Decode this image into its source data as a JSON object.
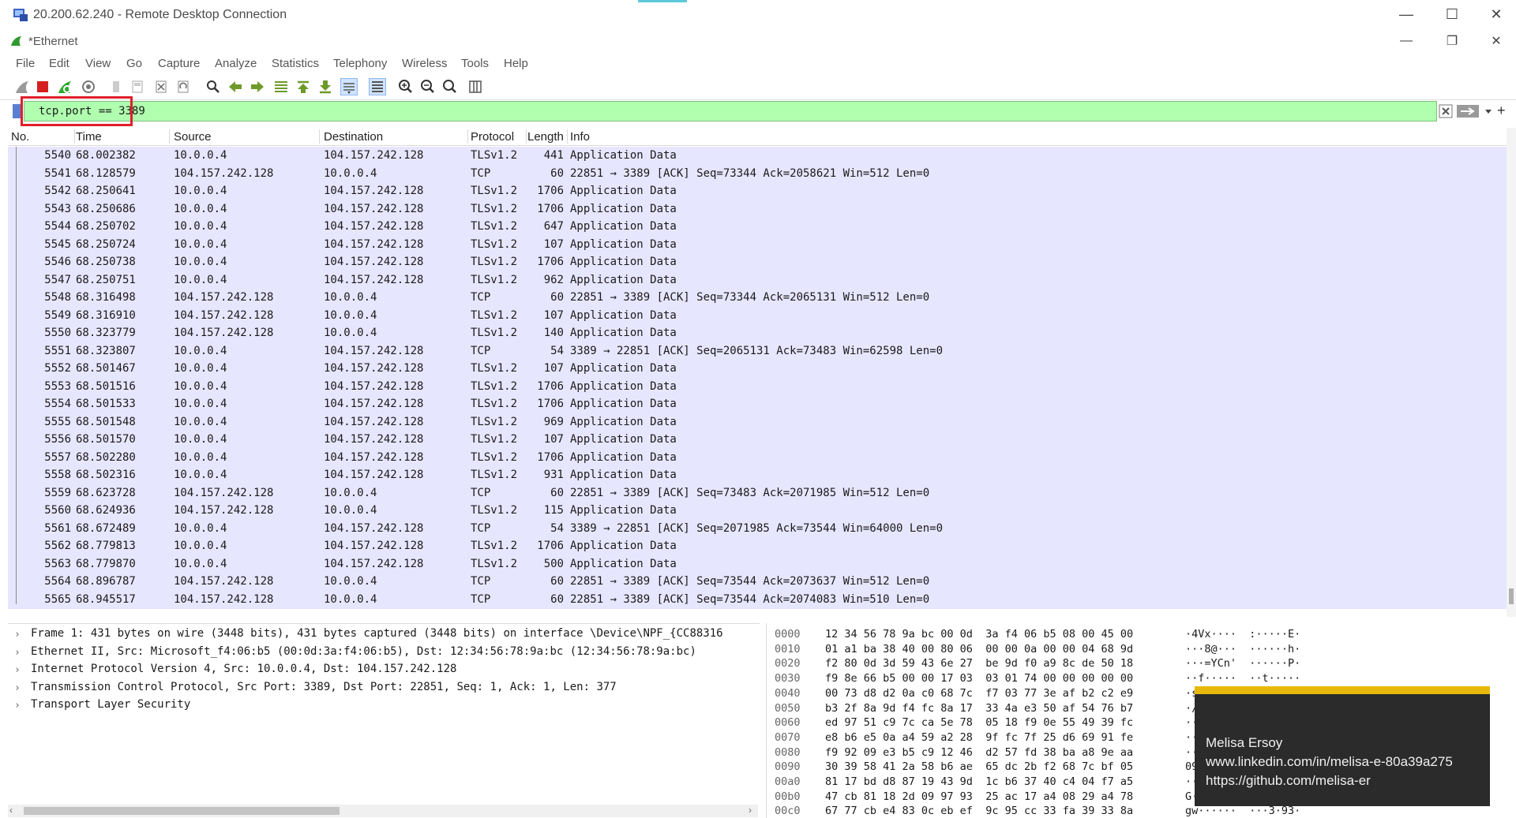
{
  "rdp": {
    "title": "20.200.62.240 - Remote Desktop Connection"
  },
  "app": {
    "title": "*Ethernet"
  },
  "menu": [
    "File",
    "Edit",
    "View",
    "Go",
    "Capture",
    "Analyze",
    "Statistics",
    "Telephony",
    "Wireless",
    "Tools",
    "Help"
  ],
  "filter": {
    "value": "tcp.port == 3389",
    "plus": "+"
  },
  "columns": [
    "No.",
    "Time",
    "Source",
    "Destination",
    "Protocol",
    "Length",
    "Info"
  ],
  "packets": [
    [
      "5540",
      "68.002382",
      "10.0.0.4",
      "104.157.242.128",
      "TLSv1.2",
      "441",
      "Application Data"
    ],
    [
      "5541",
      "68.128579",
      "104.157.242.128",
      "10.0.0.4",
      "TCP",
      "60",
      "22851 → 3389 [ACK] Seq=73344 Ack=2058621 Win=512 Len=0"
    ],
    [
      "5542",
      "68.250641",
      "10.0.0.4",
      "104.157.242.128",
      "TLSv1.2",
      "1706",
      "Application Data"
    ],
    [
      "5543",
      "68.250686",
      "10.0.0.4",
      "104.157.242.128",
      "TLSv1.2",
      "1706",
      "Application Data"
    ],
    [
      "5544",
      "68.250702",
      "10.0.0.4",
      "104.157.242.128",
      "TLSv1.2",
      "647",
      "Application Data"
    ],
    [
      "5545",
      "68.250724",
      "10.0.0.4",
      "104.157.242.128",
      "TLSv1.2",
      "107",
      "Application Data"
    ],
    [
      "5546",
      "68.250738",
      "10.0.0.4",
      "104.157.242.128",
      "TLSv1.2",
      "1706",
      "Application Data"
    ],
    [
      "5547",
      "68.250751",
      "10.0.0.4",
      "104.157.242.128",
      "TLSv1.2",
      "962",
      "Application Data"
    ],
    [
      "5548",
      "68.316498",
      "104.157.242.128",
      "10.0.0.4",
      "TCP",
      "60",
      "22851 → 3389 [ACK] Seq=73344 Ack=2065131 Win=512 Len=0"
    ],
    [
      "5549",
      "68.316910",
      "104.157.242.128",
      "10.0.0.4",
      "TLSv1.2",
      "107",
      "Application Data"
    ],
    [
      "5550",
      "68.323779",
      "104.157.242.128",
      "10.0.0.4",
      "TLSv1.2",
      "140",
      "Application Data"
    ],
    [
      "5551",
      "68.323807",
      "10.0.0.4",
      "104.157.242.128",
      "TCP",
      "54",
      "3389 → 22851 [ACK] Seq=2065131 Ack=73483 Win=62598 Len=0"
    ],
    [
      "5552",
      "68.501467",
      "10.0.0.4",
      "104.157.242.128",
      "TLSv1.2",
      "107",
      "Application Data"
    ],
    [
      "5553",
      "68.501516",
      "10.0.0.4",
      "104.157.242.128",
      "TLSv1.2",
      "1706",
      "Application Data"
    ],
    [
      "5554",
      "68.501533",
      "10.0.0.4",
      "104.157.242.128",
      "TLSv1.2",
      "1706",
      "Application Data"
    ],
    [
      "5555",
      "68.501548",
      "10.0.0.4",
      "104.157.242.128",
      "TLSv1.2",
      "969",
      "Application Data"
    ],
    [
      "5556",
      "68.501570",
      "10.0.0.4",
      "104.157.242.128",
      "TLSv1.2",
      "107",
      "Application Data"
    ],
    [
      "5557",
      "68.502280",
      "10.0.0.4",
      "104.157.242.128",
      "TLSv1.2",
      "1706",
      "Application Data"
    ],
    [
      "5558",
      "68.502316",
      "10.0.0.4",
      "104.157.242.128",
      "TLSv1.2",
      "931",
      "Application Data"
    ],
    [
      "5559",
      "68.623728",
      "104.157.242.128",
      "10.0.0.4",
      "TCP",
      "60",
      "22851 → 3389 [ACK] Seq=73483 Ack=2071985 Win=512 Len=0"
    ],
    [
      "5560",
      "68.624936",
      "104.157.242.128",
      "10.0.0.4",
      "TLSv1.2",
      "115",
      "Application Data"
    ],
    [
      "5561",
      "68.672489",
      "10.0.0.4",
      "104.157.242.128",
      "TCP",
      "54",
      "3389 → 22851 [ACK] Seq=2071985 Ack=73544 Win=64000 Len=0"
    ],
    [
      "5562",
      "68.779813",
      "10.0.0.4",
      "104.157.242.128",
      "TLSv1.2",
      "1706",
      "Application Data"
    ],
    [
      "5563",
      "68.779870",
      "10.0.0.4",
      "104.157.242.128",
      "TLSv1.2",
      "500",
      "Application Data"
    ],
    [
      "5564",
      "68.896787",
      "104.157.242.128",
      "10.0.0.4",
      "TCP",
      "60",
      "22851 → 3389 [ACK] Seq=73544 Ack=2073637 Win=512 Len=0"
    ],
    [
      "5565",
      "68.945517",
      "104.157.242.128",
      "10.0.0.4",
      "TCP",
      "60",
      "22851 → 3389 [ACK] Seq=73544 Ack=2074083 Win=510 Len=0"
    ]
  ],
  "details": [
    "Frame 1: 431 bytes on wire (3448 bits), 431 bytes captured (3448 bits) on interface \\Device\\NPF_{CC88316",
    "Ethernet II, Src: Microsoft_f4:06:b5 (00:0d:3a:f4:06:b5), Dst: 12:34:56:78:9a:bc (12:34:56:78:9a:bc)",
    "Internet Protocol Version 4, Src: 10.0.0.4, Dst: 104.157.242.128",
    "Transmission Control Protocol, Src Port: 3389, Dst Port: 22851, Seq: 1, Ack: 1, Len: 377",
    "Transport Layer Security"
  ],
  "bytes": [
    [
      "0000",
      "12 34 56 78 9a bc 00 0d  3a f4 06 b5 08 00 45 00",
      "·4Vx····  :·····E·"
    ],
    [
      "0010",
      "01 a1 ba 38 40 00 80 06  00 00 0a 00 00 04 68 9d",
      "···8@···  ······h·"
    ],
    [
      "0020",
      "f2 80 0d 3d 59 43 6e 27  be 9d f0 a9 8c de 50 18",
      "···=YCn'  ······P·"
    ],
    [
      "0030",
      "f9 8e 66 b5 00 00 17 03  03 01 74 00 00 00 00 00",
      "··f·····  ··t·····"
    ],
    [
      "0040",
      "00 73 d8 d2 0a c0 68 7c  f7 03 77 3e af b2 c2 e9",
      "·s"
    ],
    [
      "0050",
      "b3 2f 8a 9d f4 fc 8a 17  33 4a e3 50 af 54 76 b7",
      "·/"
    ],
    [
      "0060",
      "ed 97 51 c9 7c ca 5e 78  05 18 f9 0e 55 49 39 fc",
      "··Q"
    ],
    [
      "0070",
      "e8 b6 e5 0a a4 59 a2 28  9f fc 7f 25 d6 69 91 fe",
      "···"
    ],
    [
      "0080",
      "f9 92 09 e3 b5 c9 12 46  d2 57 fd 38 ba a8 9e aa",
      "···"
    ],
    [
      "0090",
      "30 39 58 41 2a 58 b6 ae  65 dc 2b f2 68 7c bf 05",
      "09X"
    ],
    [
      "00a0",
      "81 17 bd d8 87 19 43 9d  1c b6 37 40 c4 04 f7 a5",
      "···"
    ],
    [
      "00b0",
      "47 cb 81 18 2d 09 97 93  25 ac 17 a4 08 29 a4 78",
      "G··"
    ],
    [
      "00c0",
      "67 77 cb e4 83 0c eb ef  9c 95 cc 33 fa 39 33 8a",
      "gw······  ···3·93·"
    ]
  ],
  "toast": {
    "name": "Melisa Ersoy",
    "linkedin": "www.linkedin.com/in/melisa-e-80a39a275",
    "github": "https://github.com/melisa-er"
  },
  "colors": {
    "filter_bg": "#afffaf",
    "list_bg": "#e7e6ff",
    "highlight": "#e0202a",
    "toast_accent": "#e8b90c"
  }
}
